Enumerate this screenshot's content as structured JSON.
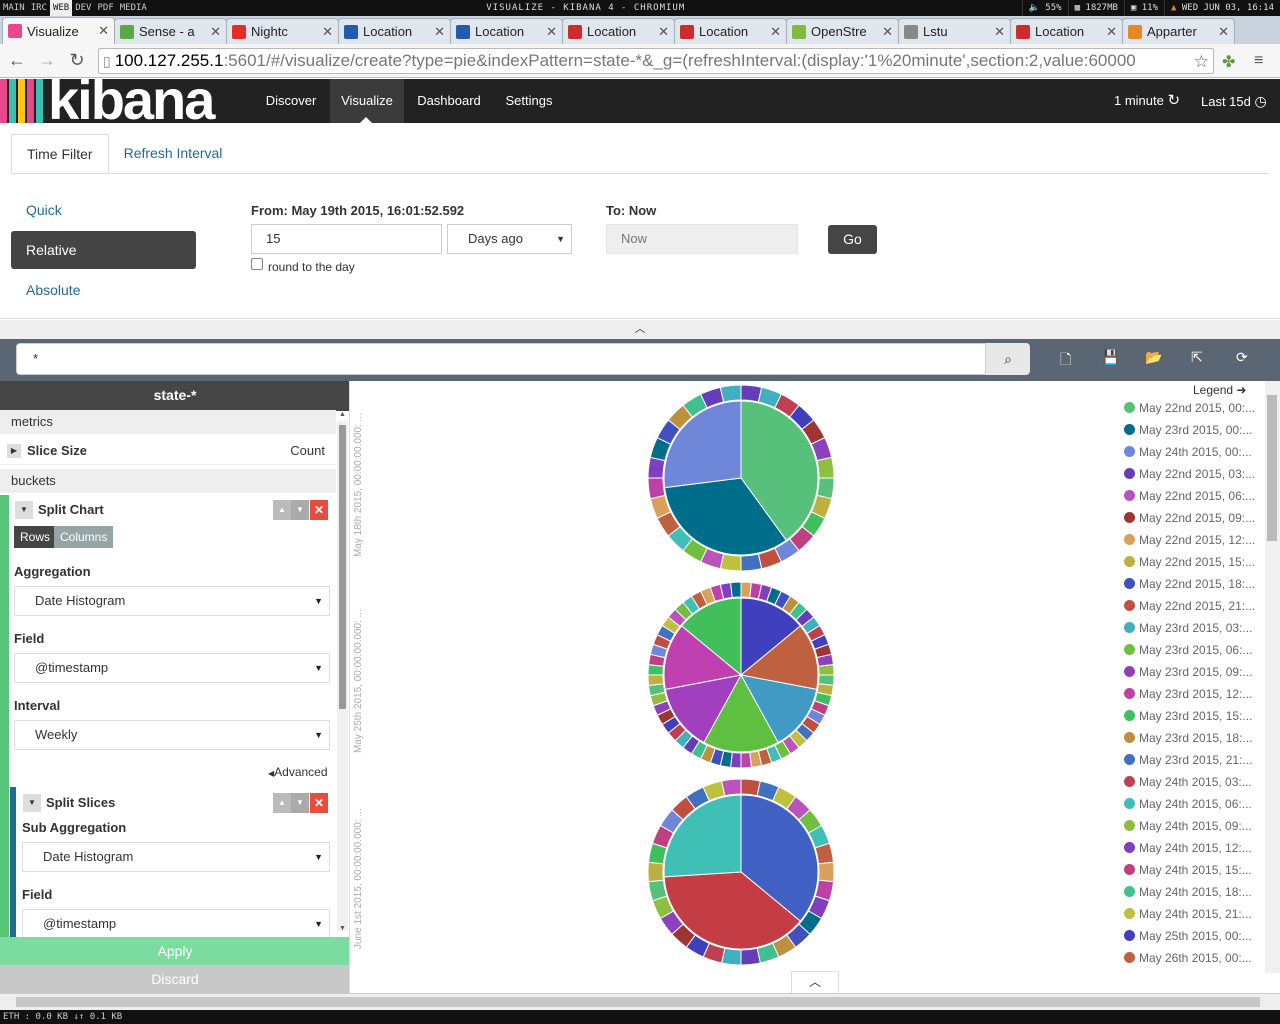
{
  "system_bar": {
    "workspaces": [
      "MAIN",
      "IRC",
      "WEB",
      "DEV",
      "PDF",
      "MEDIA"
    ],
    "window_title": "VISUALIZE - KIBANA 4 - CHROMIUM",
    "volume": "55%",
    "memory": "1827MB",
    "cpu": "11%",
    "datetime": "WED JUN 03, 16:14"
  },
  "browser_tabs": [
    {
      "title": "Visualize",
      "color": "#e8478b"
    },
    {
      "title": "Sense - a",
      "color": "#5aa846"
    },
    {
      "title": "Nightc",
      "color": "#e52d27"
    },
    {
      "title": "Location",
      "color": "#1f5cab"
    },
    {
      "title": "Location",
      "color": "#1f5cab"
    },
    {
      "title": "Location",
      "color": "#d02b2b"
    },
    {
      "title": "Location",
      "color": "#d02b2b"
    },
    {
      "title": "OpenStre",
      "color": "#7ebc3f"
    },
    {
      "title": "Lstu",
      "color": "#888888"
    },
    {
      "title": "Location",
      "color": "#d02b2b"
    },
    {
      "title": "Apparter",
      "color": "#e8862a"
    }
  ],
  "address": {
    "host": "100.127.255.1",
    "rest": ":5601/#/visualize/create?type=pie&indexPattern=state-*&_g=(refreshInterval:(display:'1%20minute',section:2,value:60000"
  },
  "kibana_nav": {
    "logo": "kibana",
    "items": [
      "Discover",
      "Visualize",
      "Dashboard",
      "Settings"
    ],
    "refresh_label": "1 minute",
    "time_label": "Last 15d"
  },
  "time_filter": {
    "tabs": [
      "Time Filter",
      "Refresh Interval"
    ],
    "modes": [
      "Quick",
      "Relative",
      "Absolute"
    ],
    "from_label": "From: May 19th 2015, 16:01:52.592",
    "from_value": "15",
    "from_unit": "Days ago",
    "round_label": "round to the day",
    "to_label": "To: Now",
    "to_value": "Now",
    "go_label": "Go"
  },
  "query": {
    "value": "*"
  },
  "sidebar": {
    "index_pattern": "state-*",
    "metrics_label": "metrics",
    "slice_size_label": "Slice Size",
    "slice_size_value": "Count",
    "buckets_label": "buckets",
    "split_chart_label": "Split Chart",
    "rows_label": "Rows",
    "columns_label": "Columns",
    "aggregation_label": "Aggregation",
    "aggregation_value": "Date Histogram",
    "field_label": "Field",
    "field_value": "@timestamp",
    "interval_label": "Interval",
    "interval_value": "Weekly",
    "advanced_label": "Advanced",
    "split_slices_label": "Split Slices",
    "sub_aggregation_label": "Sub Aggregation",
    "sub_aggregation_value": "Date Histogram",
    "sub_field_label": "Field",
    "sub_field_value": "@timestamp",
    "apply_label": "Apply",
    "discard_label": "Discard"
  },
  "legend": {
    "title": "Legend",
    "items": [
      {
        "label": "May 22nd 2015, 00:...",
        "color": "#57c17b"
      },
      {
        "label": "May 23rd 2015, 00:...",
        "color": "#006e8a"
      },
      {
        "label": "May 24th 2015, 00:...",
        "color": "#6f87d8"
      },
      {
        "label": "May 22nd 2015, 03:...",
        "color": "#663db8"
      },
      {
        "label": "May 22nd 2015, 06:...",
        "color": "#bc52bc"
      },
      {
        "label": "May 22nd 2015, 09:...",
        "color": "#9e3533"
      },
      {
        "label": "May 22nd 2015, 12:...",
        "color": "#daa05d"
      },
      {
        "label": "May 22nd 2015, 15:...",
        "color": "#bfaf40"
      },
      {
        "label": "May 22nd 2015, 18:...",
        "color": "#4050bf"
      },
      {
        "label": "May 22nd 2015, 21:...",
        "color": "#bf5040"
      },
      {
        "label": "May 23rd 2015, 03:...",
        "color": "#40afbf"
      },
      {
        "label": "May 23rd 2015, 06:...",
        "color": "#70bf40"
      },
      {
        "label": "May 23rd 2015, 09:...",
        "color": "#8f40bf"
      },
      {
        "label": "May 23rd 2015, 12:...",
        "color": "#bf40a7"
      },
      {
        "label": "May 23rd 2015, 15:...",
        "color": "#40bf5f"
      },
      {
        "label": "May 23rd 2015, 18:...",
        "color": "#bf8f40"
      },
      {
        "label": "May 23rd 2015, 21:...",
        "color": "#4070bf"
      },
      {
        "label": "May 24th 2015, 03:...",
        "color": "#bf4050"
      },
      {
        "label": "May 24th 2015, 06:...",
        "color": "#40bfb7"
      },
      {
        "label": "May 24th 2015, 09:...",
        "color": "#8fbf40"
      },
      {
        "label": "May 24th 2015, 12:...",
        "color": "#7f40bf"
      },
      {
        "label": "May 24th 2015, 15:...",
        "color": "#bf4080"
      },
      {
        "label": "May 24th 2015, 18:...",
        "color": "#40bf8f"
      },
      {
        "label": "May 24th 2015, 21:...",
        "color": "#bfbf40"
      },
      {
        "label": "May 25th 2015, 00:...",
        "color": "#4040bf"
      },
      {
        "label": "May 26th 2015, 00:...",
        "color": "#bf6040"
      }
    ]
  },
  "chart_data": {
    "type": "pie",
    "rows": [
      {
        "label": "May 18th 2015, 00:00:00.000: ...",
        "inner": [
          {
            "color": "#57c17b",
            "value": 40
          },
          {
            "color": "#006e8a",
            "value": 33
          },
          {
            "color": "#6f87d8",
            "value": 27
          }
        ],
        "outer_count": 28
      },
      {
        "label": "May 25th 2015, 00:00:00.000: ...",
        "inner": [
          {
            "color": "#4040bf",
            "value": 14
          },
          {
            "color": "#bf6040",
            "value": 14
          },
          {
            "color": "#409ac4",
            "value": 14
          },
          {
            "color": "#5fbf40",
            "value": 16
          },
          {
            "color": "#a040bf",
            "value": 14
          },
          {
            "color": "#bf40b0",
            "value": 14
          },
          {
            "color": "#40bf5a",
            "value": 14
          }
        ],
        "outer_count": 56
      },
      {
        "label": "June 1st 2015, 00:00:00.000: ...",
        "inner": [
          {
            "color": "#4060c4",
            "value": 36
          },
          {
            "color": "#c43d45",
            "value": 38
          },
          {
            "color": "#40bfb7",
            "value": 26
          }
        ],
        "outer_count": 30
      }
    ]
  },
  "bottom_bar": {
    "text": "ETH : 0.0 KB ↓↑ 0.1 KB"
  }
}
